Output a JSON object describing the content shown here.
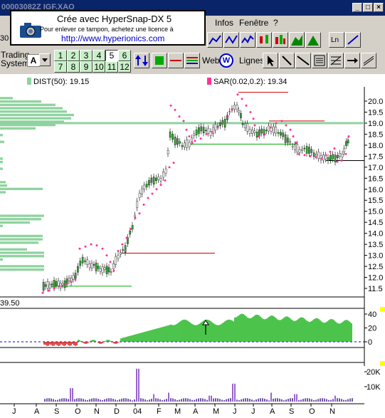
{
  "window": {
    "title": "00003082Z  IGF.XAO"
  },
  "menu": {
    "infos": "Infos",
    "fenetre": "Fenêtre",
    "help": "?"
  },
  "hypersnap": {
    "line1": "Crée avec HyperSnap-DX 5",
    "line2": "Pour enlever ce tampon, achetez une licence à",
    "line3": "http://www.hyperionics.com"
  },
  "toolbar": {
    "field_value": "30",
    "trading_label": "Trading",
    "system_label": "System",
    "system_value": "A",
    "numbers": [
      "1",
      "2",
      "3",
      "4",
      "5",
      "6",
      "7",
      "8",
      "9",
      "10",
      "11",
      "12"
    ],
    "selected_number": "5",
    "web_label": "Web",
    "lignes_label": "Lignes"
  },
  "indicators": {
    "dist_label": "DIST(50): 19.15",
    "sar_label": "SAR(0.02,0.2): 19.34",
    "lower_value": "39.50",
    "dist_color": "#8fd39f",
    "sar_color": "#ff3399"
  },
  "price_axis": [
    "20.0",
    "19.5",
    "19.0",
    "18.5",
    "18.0",
    "17.5",
    "17.0",
    "16.5",
    "16.0",
    "15.5",
    "15.0",
    "14.5",
    "14.0",
    "13.5",
    "13.0",
    "12.5",
    "12.0",
    "11.5"
  ],
  "osc_axis": [
    "40",
    "20",
    "0"
  ],
  "vol_axis": [
    "20K",
    "10K"
  ],
  "time_axis": [
    "J",
    "A",
    "S",
    "O",
    "N",
    "D",
    "04",
    "F",
    "M",
    "A",
    "M",
    "J",
    "J",
    "A",
    "S",
    "O",
    "N"
  ],
  "chart_data": {
    "type": "candlestick",
    "title": "",
    "ylim": [
      11.25,
      20.25
    ],
    "approx_closes": [
      11.5,
      11.8,
      12.5,
      12.2,
      13.2,
      15.0,
      16.5,
      18.0,
      19.0,
      18.6,
      20.0,
      18.7,
      18.8,
      17.8,
      17.6,
      17.3,
      18.5
    ],
    "last_value": 19.15
  }
}
